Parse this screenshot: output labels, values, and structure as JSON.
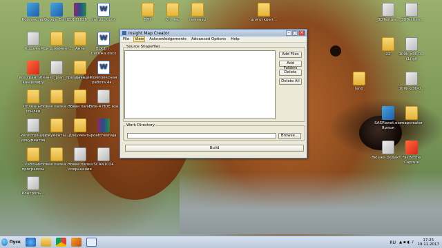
{
  "desktop": {
    "icons_left": [
      {
        "label": "Компьютер",
        "kind": "app"
      },
      {
        "label": "Google Earth",
        "kind": "app"
      },
      {
        "label": "20171028_...",
        "kind": "rar"
      },
      {
        "label": "запрос.docx",
        "kind": "word"
      },
      {
        "label": "Корзина",
        "kind": "misc"
      },
      {
        "label": "Мои документ...",
        "kind": "folder"
      },
      {
        "label": "Анге",
        "kind": "folder"
      },
      {
        "label": "ВОСЬ г. Сегежа.docx",
        "kind": "word"
      },
      {
        "label": "все гранты на канцеляру",
        "kind": "red"
      },
      {
        "label": "бизнес_plan_презентация",
        "kind": "misc"
      },
      {
        "label": "дача",
        "kind": "folder"
      },
      {
        "label": "Комплексная работа 4к...",
        "kind": "word"
      },
      {
        "label": "Полезные ссылки",
        "kind": "folder"
      },
      {
        "label": "Новая папка (3)",
        "kind": "folder"
      },
      {
        "label": "Новая папка",
        "kind": "folder"
      },
      {
        "label": "Elite-4 HDE.exe",
        "kind": "misc"
      },
      {
        "label": "Регистрация документов",
        "kind": "misc"
      },
      {
        "label": "Документы ...",
        "kind": "folder"
      },
      {
        "label": "Документы",
        "kind": "folder"
      },
      {
        "label": "poetchesnaja",
        "kind": "rar"
      },
      {
        "label": "Рабочие программы",
        "kind": "folder"
      },
      {
        "label": "Новая папка (2)",
        "kind": "folder"
      },
      {
        "label": "Новая папка сохранение",
        "kind": "misc"
      },
      {
        "label": "SCAN1024",
        "kind": "misc"
      },
      {
        "label": "Контроль...",
        "kind": "misc"
      }
    ],
    "icons_top": [
      {
        "label": "ВПР",
        "kind": "folder"
      },
      {
        "label": "кл. час",
        "kind": "folder"
      },
      {
        "label": "семинар",
        "kind": "folder"
      },
      {
        "label": "для открыт...",
        "kind": "folder"
      }
    ],
    "icons_right": [
      {
        "label": "_3DTexture...",
        "kind": "misc"
      },
      {
        "label": "_3DTexture...",
        "kind": "misc"
      },
      {
        "label": "22",
        "kind": "folder"
      },
      {
        "label": "100k-p36-0... (1).gif",
        "kind": "misc"
      },
      {
        "label": "land",
        "kind": "folder"
      },
      {
        "label": "100k-p36-0...",
        "kind": "misc"
      },
      {
        "label": "SASPlanet.exe Ярлык",
        "kind": "app"
      },
      {
        "label": "mapcreator",
        "kind": "folder"
      },
      {
        "label": "Вюшка редакт...",
        "kind": "misc"
      },
      {
        "label": "FastStone Capture",
        "kind": "red"
      }
    ]
  },
  "window": {
    "title": "Insight Map Creator",
    "menu": [
      "File",
      "View",
      "Acknowledgements",
      "Advanced Options",
      "Help"
    ],
    "source_group": "Source Shapefiles",
    "buttons": {
      "add_files": "Add Files",
      "add_folders": "Add Folders",
      "delete": "Delete",
      "delete_all": "Delete All",
      "browse": "Browse...",
      "build": "Build"
    },
    "work_dir_group": "Work Directory",
    "work_dir_value": ""
  },
  "taskbar": {
    "start_label": "Пуск",
    "apps": [
      "ie-icon",
      "explorer-icon",
      "chrome-icon",
      "media-icon",
      "map-creator-icon"
    ],
    "lang": "RU",
    "time": "17:25",
    "date": "19.11.2017"
  }
}
